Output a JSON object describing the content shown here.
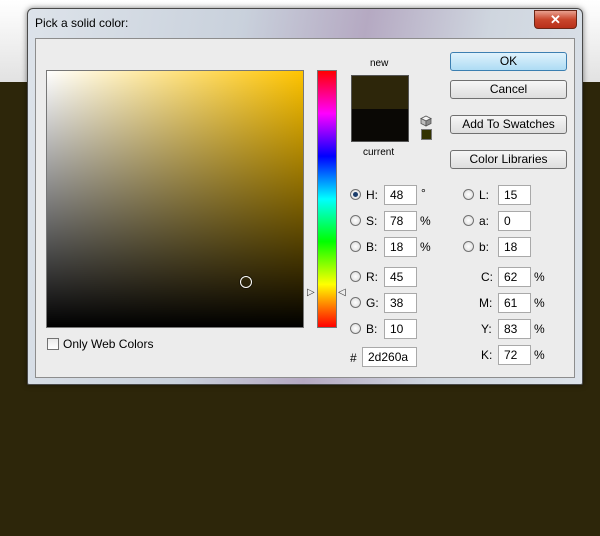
{
  "dialog": {
    "title": "Pick a solid color:",
    "close_symbol": "✕"
  },
  "preview": {
    "new_label": "new",
    "current_label": "current",
    "new_color": "#2d260a",
    "current_color": "#0a0805",
    "cube_icon": "cube-icon"
  },
  "buttons": {
    "ok": "OK",
    "cancel": "Cancel",
    "add_to_swatches": "Add To Swatches",
    "color_libraries": "Color Libraries"
  },
  "hsb": {
    "h_label": "H:",
    "h_value": "48",
    "h_unit": "°",
    "s_label": "S:",
    "s_value": "78",
    "s_unit": "%",
    "b_label": "B:",
    "b_value": "18",
    "b_unit": "%"
  },
  "rgb": {
    "r_label": "R:",
    "r_value": "45",
    "g_label": "G:",
    "g_value": "38",
    "b_label": "B:",
    "b_value": "10"
  },
  "lab": {
    "l_label": "L:",
    "l_value": "15",
    "a_label": "a:",
    "a_value": "0",
    "b_label": "b:",
    "b_value": "18"
  },
  "cmyk": {
    "c_label": "C:",
    "c_value": "62",
    "c_unit": "%",
    "m_label": "M:",
    "m_value": "61",
    "m_unit": "%",
    "y_label": "Y:",
    "y_value": "83",
    "y_unit": "%",
    "k_label": "K:",
    "k_value": "72",
    "k_unit": "%"
  },
  "hex": {
    "label": "#",
    "value": "2d260a"
  },
  "only_web_colors": {
    "label": "Only Web Colors",
    "checked": false
  },
  "colors": {
    "background": "#2d260a",
    "field_hue": "#ffc400"
  }
}
